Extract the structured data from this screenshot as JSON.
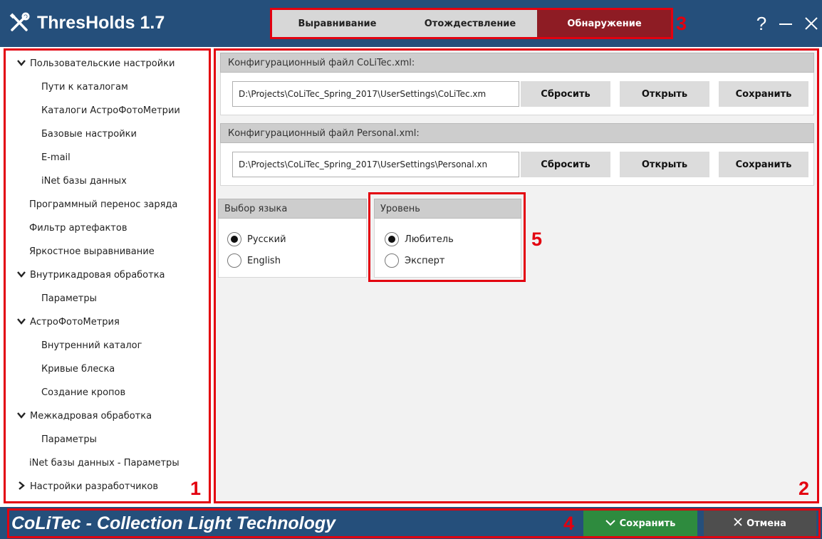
{
  "app": {
    "title": "ThresHolds 1.7"
  },
  "tabs": [
    {
      "label": "Выравнивание"
    },
    {
      "label": "Отождествление"
    },
    {
      "label": "Обнаружение"
    }
  ],
  "window": {
    "help": "?"
  },
  "sidebar": {
    "items": [
      {
        "label": "Пользовательские настройки",
        "expanded": true
      },
      {
        "label": "Пути к каталогам"
      },
      {
        "label": "Каталоги АстроФотоМетрии"
      },
      {
        "label": "Базовые настройки"
      },
      {
        "label": "E-mail"
      },
      {
        "label": "iNet базы данных"
      },
      {
        "label": "Программный перенос заряда"
      },
      {
        "label": "Фильтр артефактов"
      },
      {
        "label": "Яркостное выравнивание"
      },
      {
        "label": "Внутрикадровая обработка",
        "expanded": true
      },
      {
        "label": "Параметры"
      },
      {
        "label": "АстроФотоМетрия",
        "expanded": true
      },
      {
        "label": "Внутренний каталог"
      },
      {
        "label": "Кривые блеска"
      },
      {
        "label": "Создание кропов"
      },
      {
        "label": "Межкадровая обработка",
        "expanded": true
      },
      {
        "label": "Параметры"
      },
      {
        "label": "iNet базы данных - Параметры"
      },
      {
        "label": "Настройки разработчиков",
        "expanded": false
      }
    ]
  },
  "config_colitec": {
    "header": "Конфигурационный файл CoLiTec.xml:",
    "path": "D:\\Projects\\CoLiTec_Spring_2017\\UserSettings\\CoLiTec.xm",
    "reset": "Сбросить",
    "open": "Открыть",
    "save": "Сохранить"
  },
  "config_personal": {
    "header": "Конфигурационный файл Personal.xml:",
    "path": "D:\\Projects\\CoLiTec_Spring_2017\\UserSettings\\Personal.xn",
    "reset": "Сбросить",
    "open": "Открыть",
    "save": "Сохранить"
  },
  "language": {
    "header": "Выбор языка",
    "options": [
      {
        "label": "Русский",
        "selected": true
      },
      {
        "label": "English",
        "selected": false
      }
    ]
  },
  "level": {
    "header": "Уровень",
    "options": [
      {
        "label": "Любитель",
        "selected": true
      },
      {
        "label": "Эксперт",
        "selected": false
      }
    ]
  },
  "footer": {
    "title": "CoLiTec - Collection Light Technology",
    "save": "Сохранить",
    "cancel": "Отмена"
  },
  "annotations": [
    "1",
    "2",
    "3",
    "4",
    "5"
  ],
  "colors": {
    "titlebar": "#254f7b",
    "active_tab": "#8e1c24",
    "highlight": "#e3000f",
    "save_button": "#2e8b3e",
    "cancel_button": "#4e4e4e"
  }
}
